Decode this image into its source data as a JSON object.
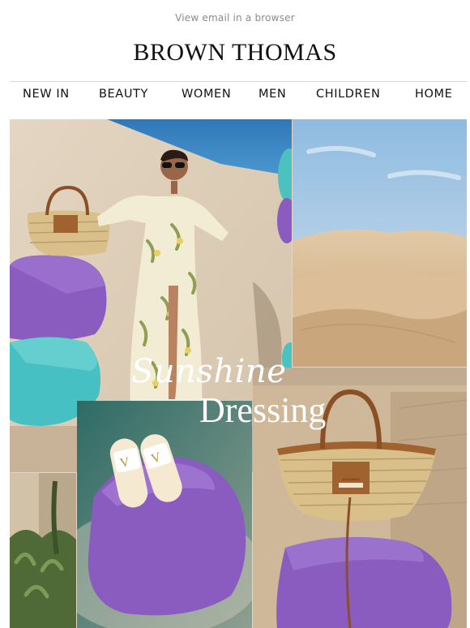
{
  "preheader": {
    "view_in_browser": "View email in a browser"
  },
  "brand": {
    "logo_text": "BROWN THOMAS"
  },
  "nav": {
    "items": [
      {
        "label": "NEW IN"
      },
      {
        "label": "BEAUTY"
      },
      {
        "label": "WOMEN"
      },
      {
        "label": "MEN"
      },
      {
        "label": "CHILDREN"
      },
      {
        "label": "HOME"
      }
    ]
  },
  "hero": {
    "headline_line1": "Sunshine",
    "headline_line2": "Dressing",
    "bag_tag_text": "JACQUEMUS"
  },
  "colors": {
    "sky_blue": "#3d86c4",
    "sand": "#dcc2a0",
    "lilac": "#8a5cc0",
    "turquoise": "#4bc2c0",
    "straw": "#d9c08a",
    "leather": "#a0622f"
  }
}
